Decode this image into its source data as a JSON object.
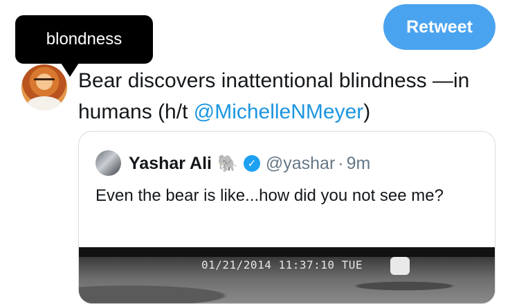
{
  "retweet_button": {
    "label": "Retweet"
  },
  "tooltip": {
    "text": "blondness"
  },
  "tweet": {
    "text_before_link": "Bear discovers inattentional blindness —in humans (h/t ",
    "mention": "@MichelleNMeyer",
    "text_after_link": ")",
    "avatar_icon": "user-avatar"
  },
  "quoted_tweet": {
    "name": "Yashar Ali",
    "emoji": "🐘",
    "verified_icon": "verified-badge-icon",
    "handle": "@yashar",
    "separator": "·",
    "time": "9m",
    "text": "Even the bear is like...how did you not see me?",
    "media_timestamp": "01/21/2014 11:37:10 TUE"
  },
  "colors": {
    "accent": "#4aa3ef",
    "link": "#1b95e0",
    "verified": "#1da1f2",
    "muted": "#657786",
    "border": "#d5dce1"
  }
}
